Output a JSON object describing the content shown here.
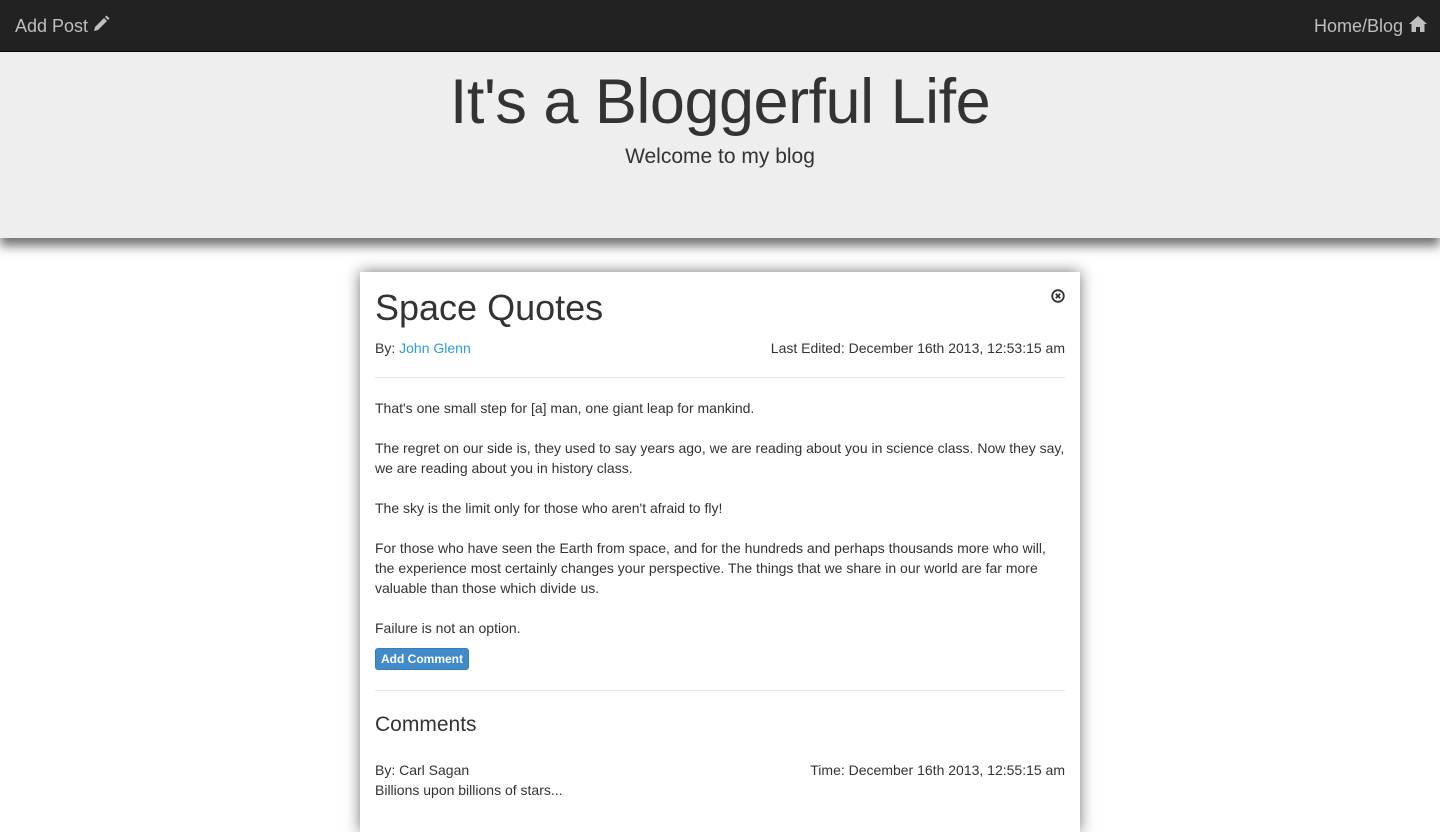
{
  "navbar": {
    "add_post_label": "Add Post",
    "add_post_icon": "pencil-icon",
    "home_label": "Home/Blog",
    "home_icon": "home-icon",
    "text_color": "#bfbfbf",
    "background": "#222222"
  },
  "header": {
    "title": "It's a Bloggerful Life",
    "subtitle": "Welcome to my blog",
    "background": "#eeeeee"
  },
  "post": {
    "title": "Space Quotes",
    "close_icon": "close-circle-icon",
    "author_prefix": "By:",
    "author": "John Glenn",
    "author_color": "#2a9fd6",
    "last_edited": "Last Edited: December 16th 2013, 12:53:15 am",
    "paragraphs": [
      "That's one small step for [a] man, one giant leap for mankind.",
      "The regret on our side is, they used to say years ago, we are reading about you in science class. Now they say, we are reading about you in history class.",
      "The sky is the limit only for those who aren't afraid to fly!",
      "For those who have seen the Earth from space, and for the hundreds and perhaps thousands more who will, the experience most certainly changes your perspective. The things that we share in our world are far more valuable than those which divide us.",
      "Failure is not an option."
    ],
    "add_comment_label": "Add Comment",
    "button_color": "#428bca"
  },
  "comments": {
    "heading": "Comments",
    "items": [
      {
        "author": "By: Carl Sagan",
        "time": "Time: December 16th 2013, 12:55:15 am",
        "text": "Billions upon billions of stars..."
      }
    ]
  }
}
